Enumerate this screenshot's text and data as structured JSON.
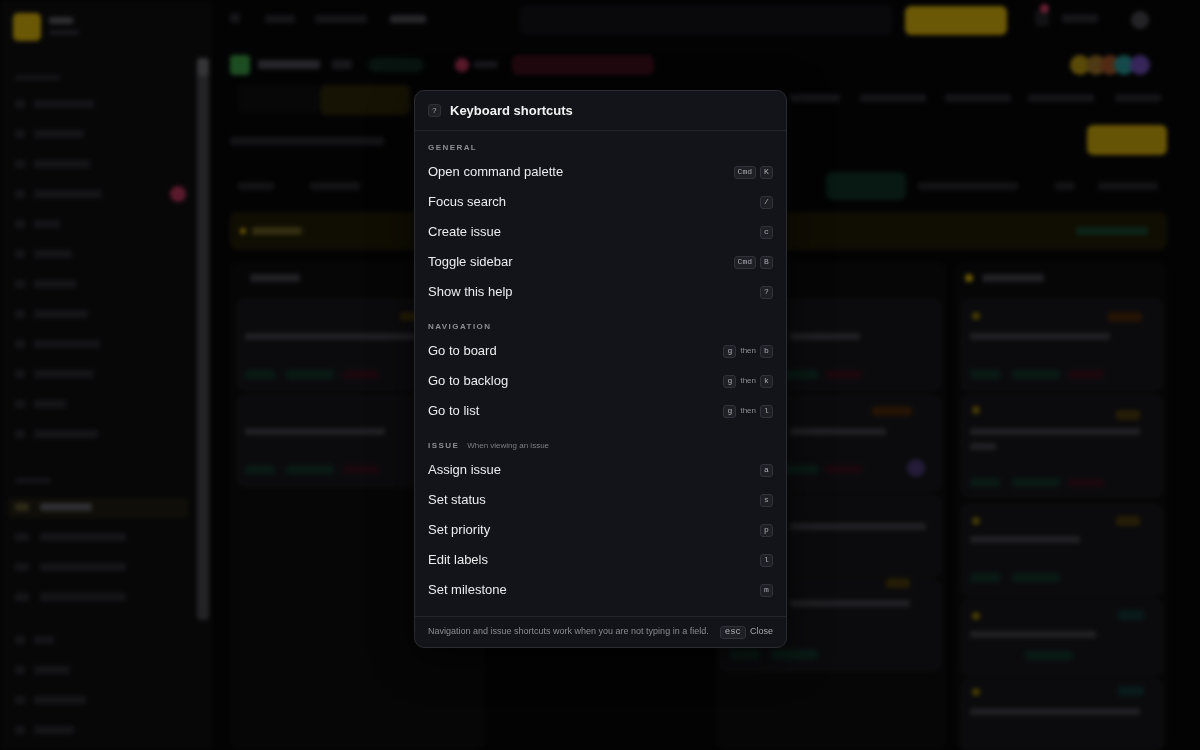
{
  "dialog": {
    "title_key": "?",
    "title": "Keyboard shortcuts",
    "sections": [
      {
        "heading": "GENERAL",
        "shortcuts": [
          {
            "action": "Open command palette",
            "keys": [
              {
                "kind": "key",
                "text": "Cmd"
              },
              {
                "kind": "key",
                "text": "K"
              }
            ]
          },
          {
            "action": "Focus search",
            "keys": [
              {
                "kind": "key",
                "text": "/"
              }
            ]
          },
          {
            "action": "Create issue",
            "keys": [
              {
                "kind": "key",
                "text": "c"
              }
            ]
          },
          {
            "action": "Toggle sidebar",
            "keys": [
              {
                "kind": "key",
                "text": "Cmd"
              },
              {
                "kind": "key",
                "text": "B"
              }
            ]
          },
          {
            "action": "Show this help",
            "keys": [
              {
                "kind": "key",
                "text": "?"
              }
            ]
          }
        ]
      },
      {
        "heading": "NAVIGATION",
        "shortcuts": [
          {
            "action": "Go to board",
            "keys": [
              {
                "kind": "key",
                "text": "g"
              },
              {
                "kind": "word",
                "text": "then"
              },
              {
                "kind": "key",
                "text": "b"
              }
            ]
          },
          {
            "action": "Go to backlog",
            "keys": [
              {
                "kind": "key",
                "text": "g"
              },
              {
                "kind": "word",
                "text": "then"
              },
              {
                "kind": "key",
                "text": "k"
              }
            ]
          },
          {
            "action": "Go to list",
            "keys": [
              {
                "kind": "key",
                "text": "g"
              },
              {
                "kind": "word",
                "text": "then"
              },
              {
                "kind": "key",
                "text": "l"
              }
            ]
          }
        ]
      },
      {
        "heading": "ISSUE",
        "note": "When viewing an issue",
        "shortcuts": [
          {
            "action": "Assign issue",
            "keys": [
              {
                "kind": "key",
                "text": "a"
              }
            ]
          },
          {
            "action": "Set status",
            "keys": [
              {
                "kind": "key",
                "text": "s"
              }
            ]
          },
          {
            "action": "Set priority",
            "keys": [
              {
                "kind": "key",
                "text": "p"
              }
            ]
          },
          {
            "action": "Edit labels",
            "keys": [
              {
                "kind": "key",
                "text": "l"
              }
            ]
          },
          {
            "action": "Set milestone",
            "keys": [
              {
                "kind": "key",
                "text": "m"
              }
            ]
          }
        ]
      }
    ],
    "footer": {
      "note": "Navigation and issue shortcuts work when you are not typing in a field.",
      "key": "esc",
      "action": "Close"
    }
  }
}
